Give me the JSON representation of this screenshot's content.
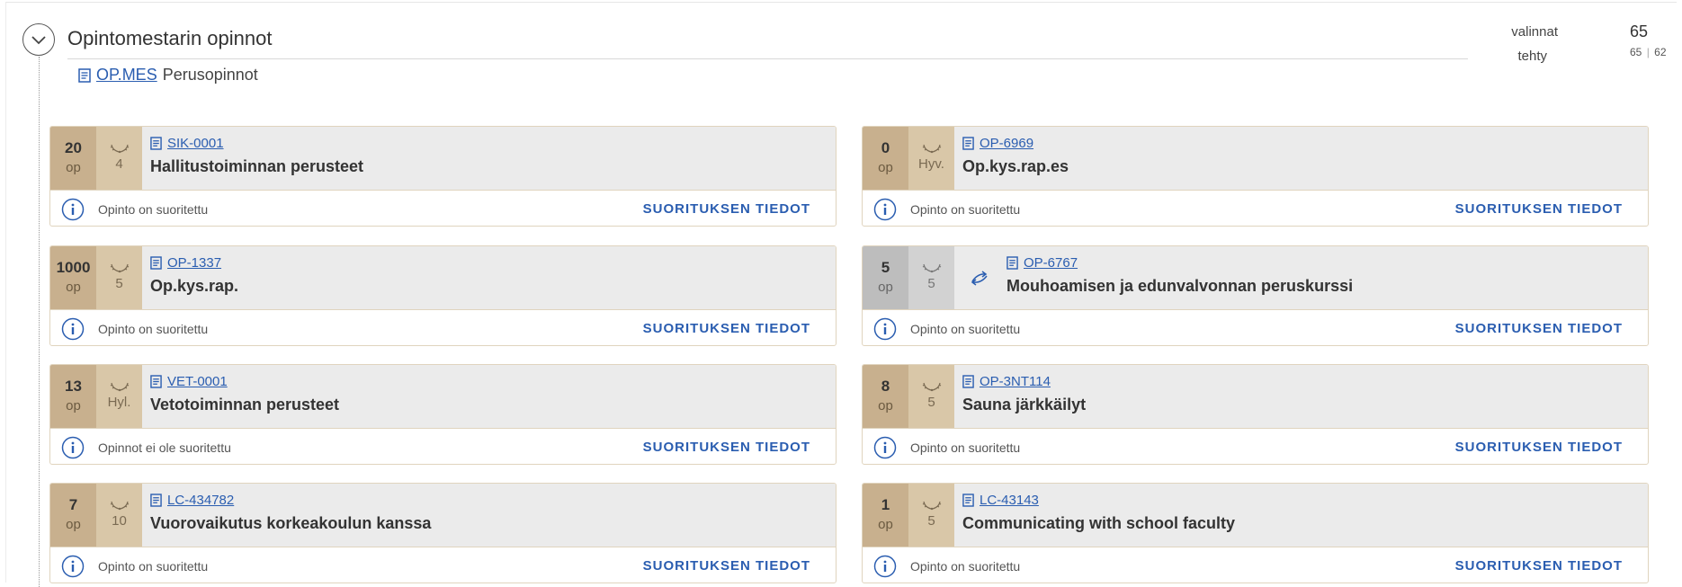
{
  "section": {
    "title": "Opintomestarin opinnot",
    "link_code": "OP.MES",
    "link_name": "Perusopinnot"
  },
  "stats": {
    "valinnat_label": "valinnat",
    "valinnat_value": "65",
    "tehty_label": "tehty",
    "tehty_value": "65",
    "tehty_total": "62"
  },
  "details_label": "SUORITUKSEN TIEDOT",
  "courses": [
    {
      "credits": "20",
      "unit": "op",
      "grade": "4",
      "code": "SIK-0001",
      "name": "Hallitustoiminnan perusteet",
      "status": "Opinto on suoritettu"
    },
    {
      "credits": "0",
      "unit": "op",
      "grade": "Hyv.",
      "code": "OP-6969",
      "name": "Op.kys.rap.es",
      "status": "Opinto on suoritettu"
    },
    {
      "credits": "1000",
      "unit": "op",
      "grade": "5",
      "code": "OP-1337",
      "name": "Op.kys.rap.",
      "status": "Opinto on suoritettu"
    },
    {
      "credits": "5",
      "unit": "op",
      "grade": "5",
      "code": "OP-6767",
      "name": "Mouhoamisen ja edunvalvonnan peruskurssi",
      "status": "Opinto on suoritettu",
      "substituted": true
    },
    {
      "credits": "13",
      "unit": "op",
      "grade": "Hyl.",
      "code": "VET-0001",
      "name": "Vetotoiminnan perusteet",
      "status": "Opinnot ei ole suoritettu"
    },
    {
      "credits": "8",
      "unit": "op",
      "grade": "5",
      "code": "OP-3NT114",
      "name": "Sauna järkkäilyt",
      "status": "Opinto on suoritettu"
    },
    {
      "credits": "7",
      "unit": "op",
      "grade": "10",
      "code": "LC-434782",
      "name": "Vuorovaikutus korkeakoulun kanssa",
      "status": "Opinto on suoritettu"
    },
    {
      "credits": "1",
      "unit": "op",
      "grade": "5",
      "code": "LC-43143",
      "name": "Communicating with school faculty",
      "status": "Opinto on suoritettu"
    }
  ],
  "icons": {
    "toggle": "chevron-down-icon",
    "document": "document-icon",
    "grade": "laurel-icon",
    "info": "info-icon",
    "substitution": "swap-arrows-icon"
  },
  "colors": {
    "credit_bg": "#c8b08e",
    "grade_bg": "#d9c7a8",
    "link": "#2a5db0",
    "substituted_bg": "#bdbdbd"
  }
}
